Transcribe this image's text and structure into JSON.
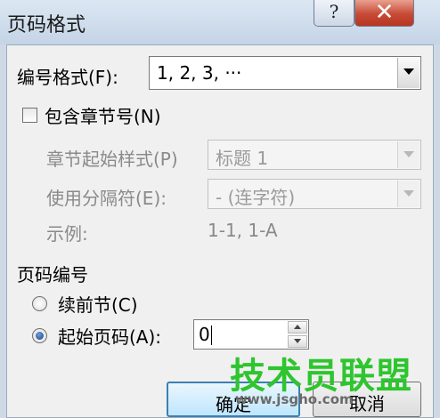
{
  "dialog": {
    "title": "页码格式",
    "help_glyph": "?",
    "close_glyph": "✕"
  },
  "number_format": {
    "label": "编号格式(F):",
    "value": "1, 2, 3, ···"
  },
  "include_chapter": {
    "label": "包含章节号(N)",
    "checked": false
  },
  "chapter_style": {
    "label": "章节起始样式(P)",
    "value": "标题 1"
  },
  "separator": {
    "label": "使用分隔符(E):",
    "value": "-   (连字符)"
  },
  "example": {
    "label": "示例:",
    "value": "1-1, 1-A"
  },
  "page_numbering": {
    "heading": "页码编号",
    "continue_label": "续前节(C)",
    "start_at_label": "起始页码(A):",
    "start_at_value": "0",
    "selected": "start_at"
  },
  "buttons": {
    "ok": "确定",
    "cancel": "取消"
  },
  "watermark": {
    "text": "技术员联盟",
    "url": "www.jsgho.com",
    "color": "#2ec52e"
  }
}
